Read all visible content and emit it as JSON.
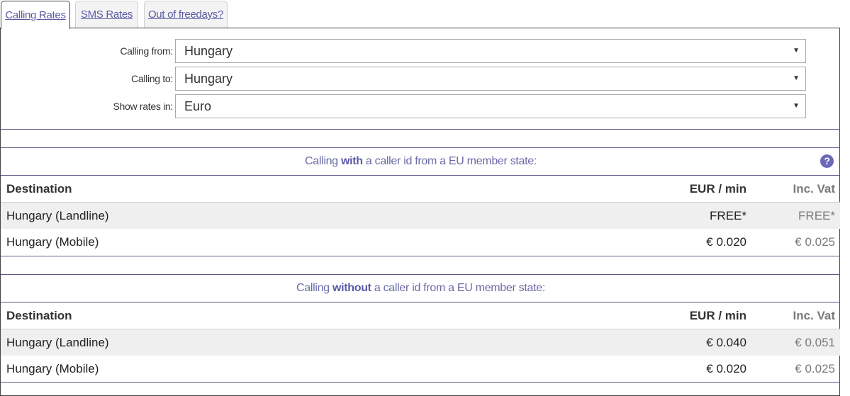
{
  "tabs": [
    {
      "label": "Calling Rates",
      "active": true
    },
    {
      "label": "SMS Rates",
      "active": false
    },
    {
      "label": "Out of freedays?",
      "active": false
    }
  ],
  "form": {
    "calling_from": {
      "label": "Calling from:",
      "value": "Hungary"
    },
    "calling_to": {
      "label": "Calling to:",
      "value": "Hungary"
    },
    "show_rates_in": {
      "label": "Show rates in:",
      "value": "Euro"
    }
  },
  "icons": {
    "dropdown_arrow": "▼",
    "help": "?"
  },
  "section_with": {
    "title_pre": "Calling ",
    "title_emph": "with",
    "title_post": " a caller id from a EU member state:",
    "headers": {
      "destination": "Destination",
      "rate": "EUR / min",
      "inc_vat": "Inc. Vat"
    },
    "rows": [
      {
        "destination": "Hungary (Landline)",
        "rate": "FREE*",
        "inc_vat": "FREE*"
      },
      {
        "destination": "Hungary (Mobile)",
        "rate": "€ 0.020",
        "inc_vat": "€ 0.025"
      }
    ]
  },
  "section_without": {
    "title_pre": "Calling ",
    "title_emph": "without",
    "title_post": " a caller id from a EU member state:",
    "headers": {
      "destination": "Destination",
      "rate": "EUR / min",
      "inc_vat": "Inc. Vat"
    },
    "rows": [
      {
        "destination": "Hungary (Landline)",
        "rate": "€ 0.040",
        "inc_vat": "€ 0.051"
      },
      {
        "destination": "Hungary (Mobile)",
        "rate": "€ 0.020",
        "inc_vat": "€ 0.025"
      }
    ]
  },
  "colors": {
    "accent": "#5b5aa6",
    "help_icon": "#6a69b8",
    "row_shade": "#efefef"
  }
}
